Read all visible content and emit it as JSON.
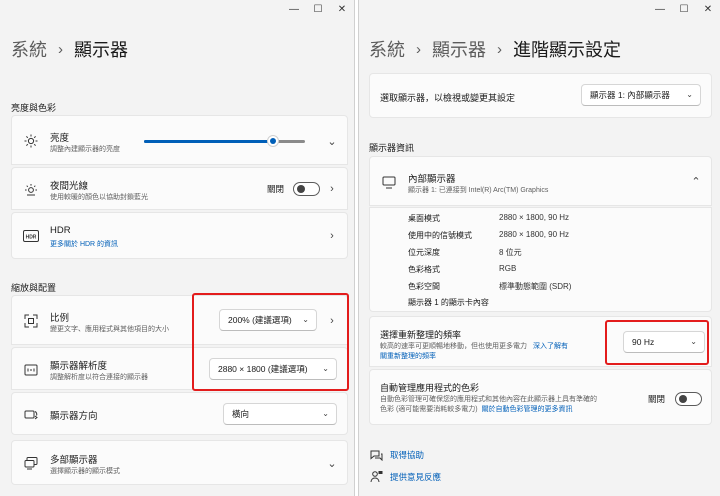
{
  "left": {
    "breadcrumb": {
      "parent": "系統",
      "current": "顯示器"
    },
    "section_brightness": "亮度與色彩",
    "brightness": {
      "title": "亮度",
      "subtitle": "調整內建顯示器的亮度",
      "level_percent": 80
    },
    "night_light": {
      "title": "夜間光線",
      "subtitle": "使用較暖的顏色以協助封鎖藍光",
      "toggle_label": "關閉"
    },
    "hdr": {
      "title": "HDR",
      "link": "更多關於 HDR 的資訊"
    },
    "section_scale": "縮放與配置",
    "scale": {
      "title": "比例",
      "subtitle": "變更文字、應用程式與其他項目的大小",
      "value": "200% (建議選項)"
    },
    "resolution": {
      "title": "顯示器解析度",
      "subtitle": "調整解析度以符合連接的顯示器",
      "value": "2880 × 1800 (建議選項)"
    },
    "orientation": {
      "title": "顯示器方向",
      "value": "橫向"
    },
    "multi": {
      "title": "多部顯示器",
      "subtitle": "選擇顯示器的顯示模式"
    }
  },
  "right": {
    "breadcrumb": {
      "a": "系統",
      "b": "顯示器",
      "current": "進階顯示設定"
    },
    "select_display": {
      "label": "選取顯示器，以檢視或變更其設定",
      "value": "顯示器 1: 內部顯示器"
    },
    "section_info": "顯示器資訊",
    "internal": {
      "title": "內部顯示器",
      "subtitle": "顯示器 1: 已連接到 Intel(R) Arc(TM) Graphics"
    },
    "info_rows": [
      {
        "label": "桌面模式",
        "value": "2880 × 1800, 90 Hz"
      },
      {
        "label": "使用中的信號模式",
        "value": "2880 × 1800, 90 Hz"
      },
      {
        "label": "位元深度",
        "value": "8 位元"
      },
      {
        "label": "色彩格式",
        "value": "RGB"
      },
      {
        "label": "色彩空間",
        "value": "標準動態範圍 (SDR)"
      }
    ],
    "adapter_link": "顯示器 1 的顯示卡內容",
    "refresh": {
      "title": "選擇重新整理的頻率",
      "subtitle": "較高的速率可更順暢地移動，但也使用更多電力",
      "link_a": "深入了解有",
      "link_b": "關重新整理的頻率",
      "value": "90 Hz"
    },
    "auto_color": {
      "title": "自動管理應用程式的色彩",
      "line1": "自動色彩管理可確保您的應用程式和其他內容在此顯示器上具有準確的",
      "line2": "色彩 (適可能需要消耗較多電力)",
      "link": "關於自動色彩管理的更多資訊",
      "toggle_label": "關閉"
    },
    "help": "取得協助",
    "feedback": "提供意見反應"
  },
  "colors": {
    "accent": "#005fb8",
    "highlight": "#e31c1c"
  }
}
